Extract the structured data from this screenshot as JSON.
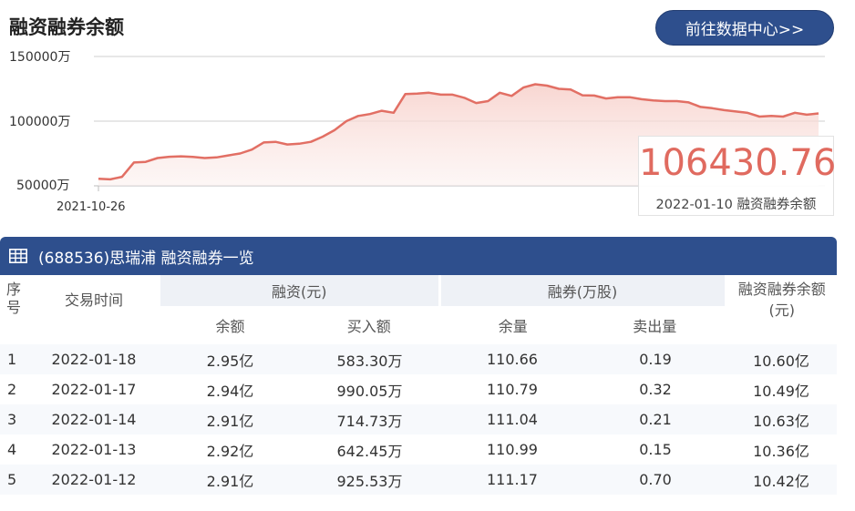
{
  "header": {
    "title": "融资融券余额",
    "button_label": "前往数据中心>>"
  },
  "chart_data": {
    "type": "area",
    "y_ticks": [
      "150000万",
      "100000万",
      "50000万"
    ],
    "x_ticks": [
      "2021-10-26"
    ],
    "ylim": [
      50000,
      150000
    ],
    "values": [
      55500,
      55000,
      57000,
      68000,
      68500,
      71500,
      72500,
      72800,
      72300,
      71500,
      72000,
      73500,
      75000,
      78000,
      83500,
      84000,
      82000,
      82500,
      84000,
      88000,
      93000,
      100000,
      104000,
      105500,
      108000,
      106500,
      121000,
      121300,
      122000,
      120500,
      120500,
      118000,
      114000,
      115500,
      122000,
      119500,
      126000,
      128500,
      127500,
      125000,
      124500,
      120000,
      119800,
      117500,
      118500,
      118500,
      117000,
      116000,
      115500,
      115500,
      114500,
      111000,
      110000,
      108500,
      107500,
      106430.76,
      103500,
      104000,
      103500,
      106500,
      105000,
      106000
    ],
    "highlight": {
      "value": "106430.76",
      "date": "2022-01-10",
      "series": "融资融券余额"
    },
    "colors": {
      "line": "#e26f64",
      "fill": "#f9dcd8"
    }
  },
  "table": {
    "title": "(688536)思瑞浦 融资融券一览",
    "headers": {
      "seq": "序号",
      "date": "交易时间",
      "rz": "融资(元)",
      "rq": "融券(万股)",
      "total": "融资融券余额(元)",
      "rz_balance": "余额",
      "rz_buy": "买入额",
      "rq_volume": "余量",
      "rq_sell": "卖出量"
    },
    "rows": [
      {
        "seq": "1",
        "date": "2022-01-18",
        "rz_balance": "2.95亿",
        "rz_buy": "583.30万",
        "rq_volume": "110.66",
        "rq_sell": "0.19",
        "total": "10.60亿"
      },
      {
        "seq": "2",
        "date": "2022-01-17",
        "rz_balance": "2.94亿",
        "rz_buy": "990.05万",
        "rq_volume": "110.79",
        "rq_sell": "0.32",
        "total": "10.49亿"
      },
      {
        "seq": "3",
        "date": "2022-01-14",
        "rz_balance": "2.91亿",
        "rz_buy": "714.73万",
        "rq_volume": "111.04",
        "rq_sell": "0.21",
        "total": "10.63亿"
      },
      {
        "seq": "4",
        "date": "2022-01-13",
        "rz_balance": "2.92亿",
        "rz_buy": "642.45万",
        "rq_volume": "110.99",
        "rq_sell": "0.15",
        "total": "10.36亿"
      },
      {
        "seq": "5",
        "date": "2022-01-12",
        "rz_balance": "2.91亿",
        "rz_buy": "925.53万",
        "rq_volume": "111.17",
        "rq_sell": "0.70",
        "total": "10.42亿"
      }
    ]
  }
}
